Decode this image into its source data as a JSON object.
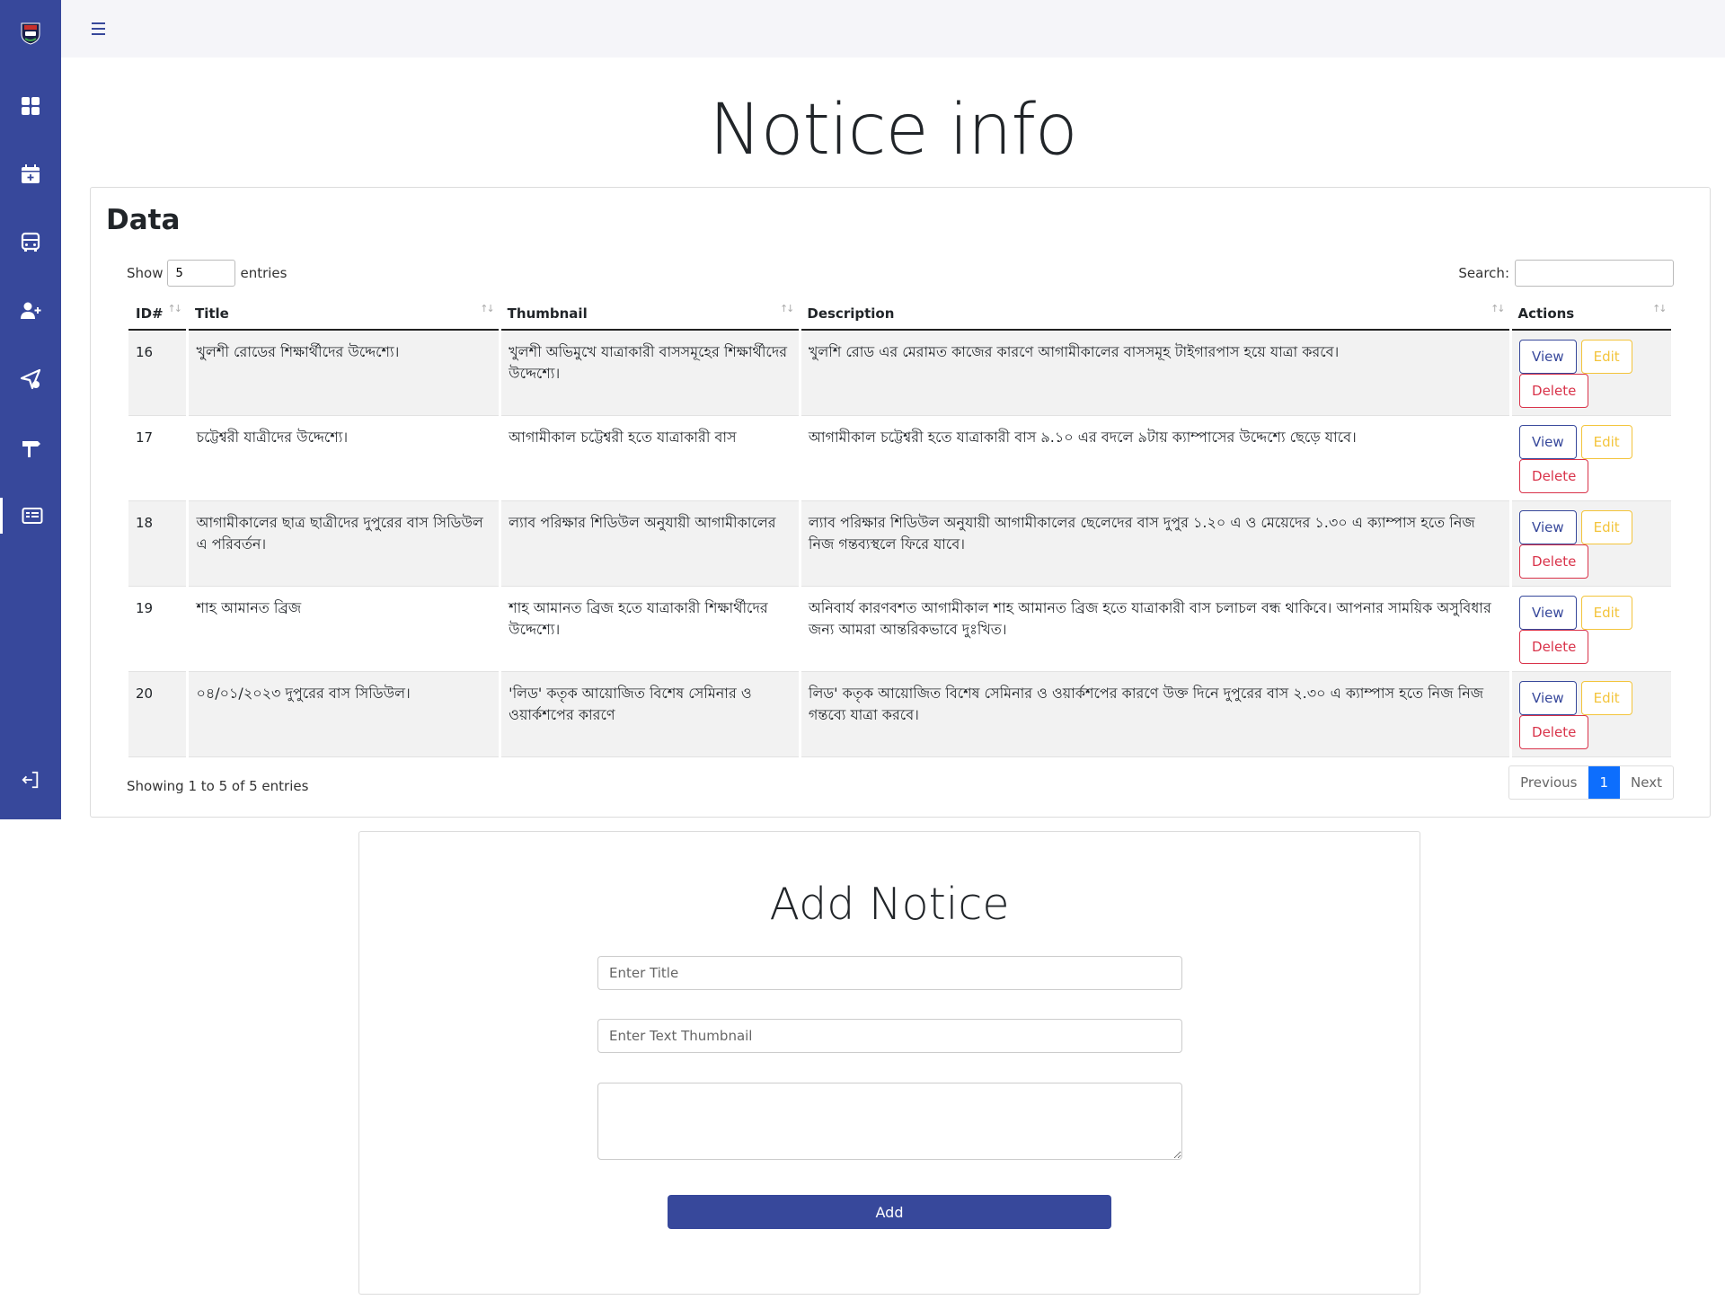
{
  "page": {
    "title": "Notice info"
  },
  "sidebar": {
    "logo_icon": "university-logo-icon",
    "items": [
      {
        "icon": "dashboard-grid-icon"
      },
      {
        "icon": "calendar-add-icon"
      },
      {
        "icon": "bus-icon"
      },
      {
        "icon": "add-user-icon"
      },
      {
        "icon": "send-icon"
      },
      {
        "icon": "signpost-icon"
      },
      {
        "icon": "notice-card-icon",
        "active": true
      }
    ],
    "logout_icon": "logout-icon"
  },
  "data_card": {
    "title": "Data",
    "show_label": "Show",
    "entries_value": "5",
    "entries_label": "entries",
    "search_label": "Search:",
    "search_value": "",
    "columns": [
      "ID#",
      "Title",
      "Thumbnail",
      "Description",
      "Actions"
    ],
    "rows": [
      {
        "id": "16",
        "title": "খুলশী রোডের শিক্ষার্থীদের উদ্দেশ্যে।",
        "thumbnail": "খুলশী অভিমুখে যাত্রাকারী বাসসমূহের শিক্ষার্থীদের উদ্দেশ্যে।",
        "description": "খুলশি রোড এর মেরামত কাজের কারণে আগামীকালের বাসসমূহ টাইগারপাস হয়ে যাত্রা করবে।"
      },
      {
        "id": "17",
        "title": "চট্টেশ্বরী যাত্রীদের উদ্দেশ্যে।",
        "thumbnail": "আগামীকাল চট্টেশ্বরী হতে যাত্রাকারী বাস",
        "description": "আগামীকাল চট্টেশ্বরী হতে যাত্রাকারী বাস ৯.১০ এর বদলে ৯টায় ক্যাম্পাসের উদ্দেশ্যে ছেড়ে যাবে।"
      },
      {
        "id": "18",
        "title": "আগামীকালের ছাত্র ছাত্রীদের দুপুরের বাস সিডিউল এ পরিবর্তন।",
        "thumbnail": "ল্যাব পরিক্ষার শিডিউল অনুযায়ী আগামীকালের",
        "description": "ল্যাব পরিক্ষার শিডিউল অনুযায়ী আগামীকালের ছেলেদের বাস দুপুর ১.২০ এ ও মেয়েদের ১.৩০ এ ক্যাম্পাস হতে নিজ নিজ গন্তব্যস্থলে ফিরে যাবে।"
      },
      {
        "id": "19",
        "title": "শাহ আমানত ব্রিজ",
        "thumbnail": "শাহ আমানত ব্রিজ হতে যাত্রাকারী শিক্ষার্থীদের উদ্দেশ্যে।",
        "description": "অনিবার্য কারণবশত আগামীকাল শাহ আমানত ব্রিজ হতে যাত্রাকারী বাস চলাচল বন্ধ থাকিবে। আপনার সাময়িক অসুবিধার জন্য আমরা আন্তরিকভাবে দুঃখিত।"
      },
      {
        "id": "20",
        "title": "০৪/০১/২০২৩ দুপুরের বাস সিডিউল।",
        "thumbnail": "'লিড' কতৃক আয়োজিত বিশেষ সেমিনার ও ওয়ার্কশপের কারণে",
        "description": "লিড' কতৃক আয়োজিত বিশেষ সেমিনার ও ওয়ার্কশপের কারণে উক্ত দিনে দুপুরের বাস ২.৩০ এ ক্যাম্পাস হতে নিজ নিজ গন্তব্যে যাত্রা করবে।"
      }
    ],
    "actions": {
      "view": "View",
      "edit": "Edit",
      "delete": "Delete"
    },
    "info_text": "Showing 1 to 5 of 5 entries",
    "pagination": {
      "previous": "Previous",
      "current": "1",
      "next": "Next"
    }
  },
  "add_notice": {
    "title": "Add Notice",
    "title_placeholder": "Enter Title",
    "thumbnail_placeholder": "Enter Text Thumbnail",
    "description_value": "",
    "submit_label": "Add"
  },
  "colors": {
    "sidebar": "#37489b",
    "primary": "#37489b",
    "edit": "#f3c43b",
    "delete": "#d9334a",
    "pager_active": "#0d6efd"
  }
}
